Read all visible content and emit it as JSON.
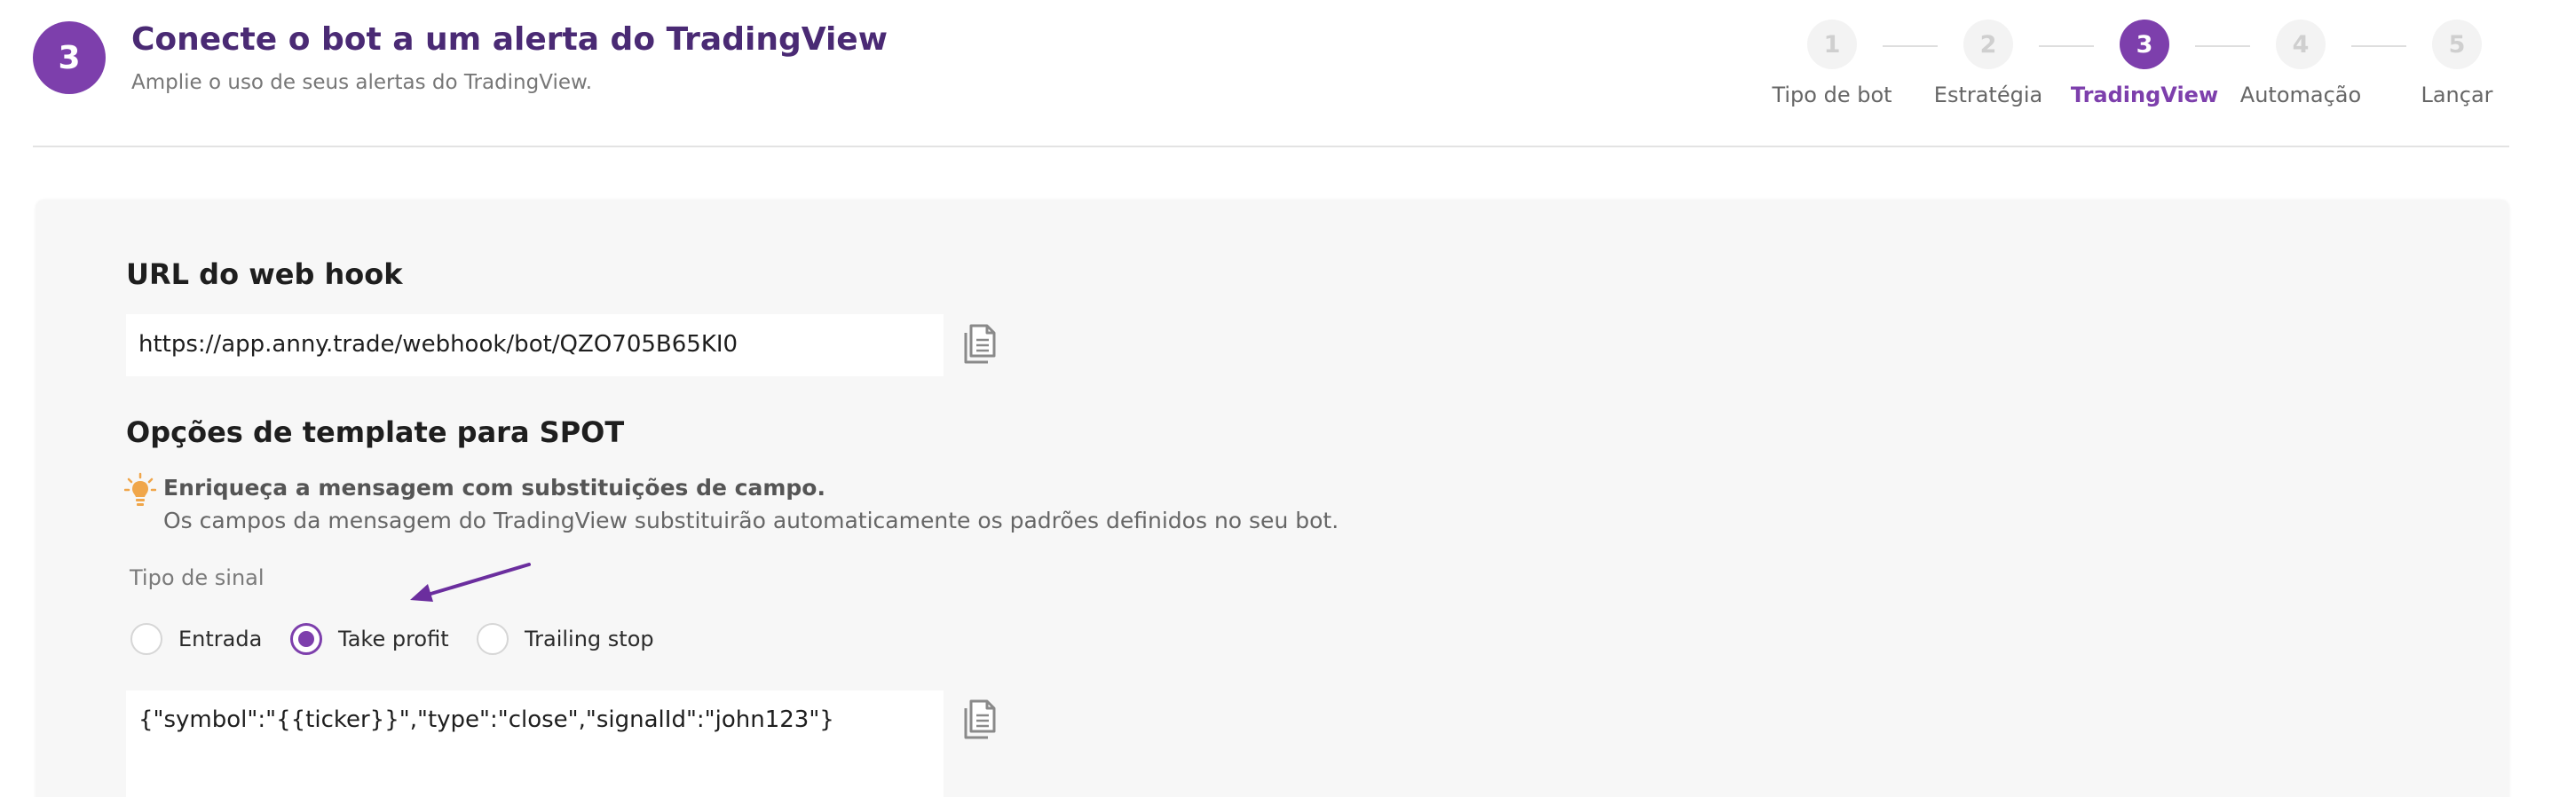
{
  "header": {
    "step_number": "3",
    "title": "Conecte o bot a um alerta do TradingView",
    "subtitle": "Amplie o uso de seus alertas do TradingView."
  },
  "stepper": {
    "steps": [
      {
        "number": "1",
        "label": "Tipo de bot",
        "active": false
      },
      {
        "number": "2",
        "label": "Estratégia",
        "active": false
      },
      {
        "number": "3",
        "label": "TradingView",
        "active": true
      },
      {
        "number": "4",
        "label": "Automação",
        "active": false
      },
      {
        "number": "5",
        "label": "Lançar",
        "active": false
      }
    ]
  },
  "webhook": {
    "label": "URL do web hook",
    "url": "https://app.anny.trade/webhook/bot/QZO705B65KI0",
    "copy_icon": "copy-icon"
  },
  "template": {
    "label": "Opções de template para SPOT",
    "tip_icon": "lightbulb-icon",
    "tip_title": "Enriqueça a mensagem com substituições de campo.",
    "tip_text": "Os campos da mensagem do TradingView substituirão automaticamente os padrões definidos no seu bot.",
    "signal_label": "Tipo de sinal",
    "signal_options": [
      {
        "label": "Entrada",
        "checked": false
      },
      {
        "label": "Take profit",
        "checked": true
      },
      {
        "label": "Trailing stop",
        "checked": false
      }
    ],
    "message": "{\"symbol\":\"{{ticker}}\",\"type\":\"close\",\"signalId\":\"john123\"}",
    "copy_icon": "copy-icon"
  },
  "colors": {
    "accent": "#7d3fac",
    "title": "#4a2a74",
    "tip_icon": "#f0a64a"
  }
}
